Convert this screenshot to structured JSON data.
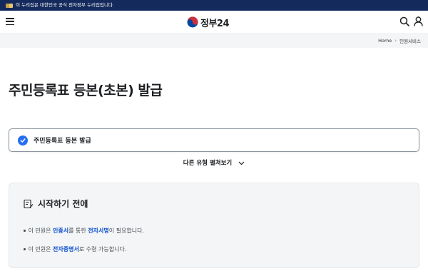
{
  "gov_banner": {
    "text": "이 누리집은 대한민국 공식 전자정부 누리집입니다."
  },
  "header": {
    "logo_text": "정부24"
  },
  "breadcrumb": [
    "Home",
    "민원서비스"
  ],
  "page": {
    "title": "주민등록표 등본(초본) 발급"
  },
  "service": {
    "selected": "주민등록표 등본 발급"
  },
  "other_types": {
    "label": "다른 유형 펼쳐보기"
  },
  "before_start": {
    "title": "시작하기 전에",
    "notes": [
      {
        "pre": "이 민원은 ",
        "hl1": "인증서",
        "mid": "를 통한 ",
        "hl2": "전자서명",
        "post": "이 필요합니다."
      },
      {
        "pre": "이 민원은 ",
        "hl1": "전자증명서",
        "post": "로 수령 가능합니다."
      }
    ]
  },
  "colors": {
    "accent": "#256ef4",
    "banner": "#142a5c",
    "link": "#0b50d0"
  }
}
